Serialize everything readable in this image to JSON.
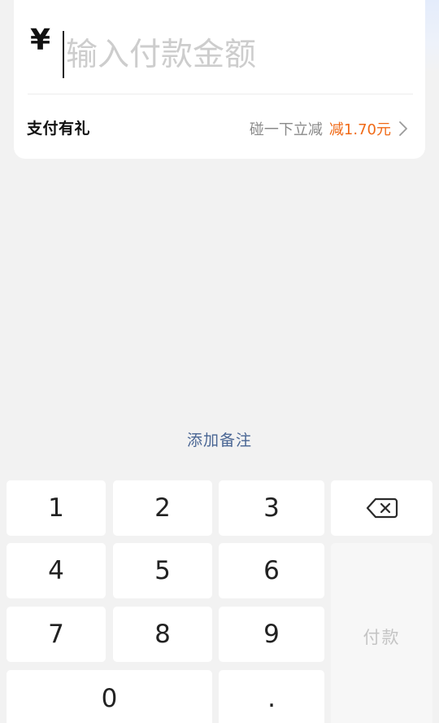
{
  "amount": {
    "currency_symbol": "¥",
    "placeholder": "输入付款金额"
  },
  "promo": {
    "title": "支付有礼",
    "hint": "碰一下立减",
    "discount": "减1.70元"
  },
  "remark_link": "添加备注",
  "keypad": {
    "keys": [
      "1",
      "2",
      "3",
      "4",
      "5",
      "6",
      "7",
      "8",
      "9",
      "0",
      "."
    ],
    "pay_label": "付款",
    "delete_icon": "backspace-icon"
  },
  "colors": {
    "discount": "#f06a17",
    "remark_link": "#4a6694",
    "pay_disabled_text": "#c4c4c4"
  }
}
